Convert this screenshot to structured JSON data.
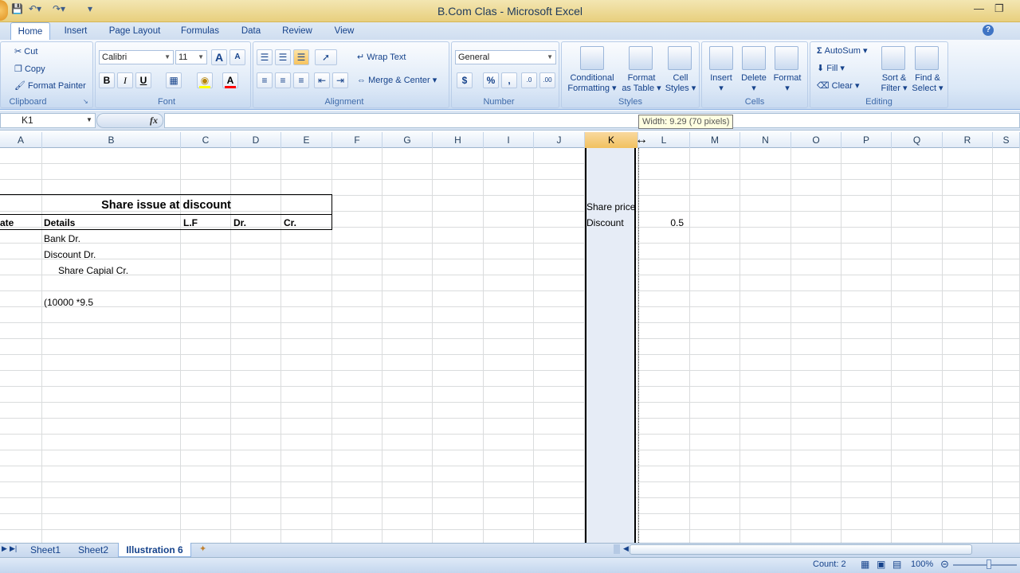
{
  "window": {
    "title": "B.Com Clas - Microsoft Excel"
  },
  "tabs": [
    "Home",
    "Insert",
    "Page Layout",
    "Formulas",
    "Data",
    "Review",
    "View"
  ],
  "clipboard": {
    "cut": "Cut",
    "copy": "Copy",
    "format_painter": "Format Painter",
    "label": "Clipboard"
  },
  "font": {
    "name": "Calibri",
    "size": "11",
    "label": "Font",
    "bold": "B",
    "italic": "I",
    "underline": "U",
    "grow": "A",
    "shrink": "A",
    "color": "A"
  },
  "alignment": {
    "wrap": "Wrap Text",
    "merge": "Merge & Center",
    "label": "Alignment"
  },
  "number": {
    "format": "General",
    "label": "Number",
    "currency": "$",
    "percent": "%",
    "comma": ","
  },
  "styles": {
    "conditional_1": "Conditional",
    "conditional_2": "Formatting",
    "format_table_1": "Format",
    "format_table_2": "as Table",
    "cell_styles_1": "Cell",
    "cell_styles_2": "Styles",
    "label": "Styles"
  },
  "cells": {
    "insert": "Insert",
    "delete": "Delete",
    "format": "Format",
    "label": "Cells"
  },
  "editing": {
    "autosum": "AutoSum",
    "fill": "Fill",
    "clear": "Clear",
    "sort_1": "Sort &",
    "sort_2": "Filter",
    "find_1": "Find &",
    "find_2": "Select",
    "label": "Editing"
  },
  "formula_bar": {
    "name_box": "K1",
    "fx": "fx",
    "tooltip": "Width: 9.29 (70 pixels)"
  },
  "columns": [
    "A",
    "B",
    "C",
    "D",
    "E",
    "F",
    "G",
    "H",
    "I",
    "J",
    "K",
    "L",
    "M",
    "N",
    "O",
    "P",
    "Q",
    "R",
    "S"
  ],
  "sheet": {
    "title": "Share issue at discount",
    "headers": {
      "date": "ate",
      "details": "Details",
      "lf": "L.F",
      "dr": "Dr.",
      "cr": "Cr."
    },
    "rows": [
      "Bank Dr.",
      "Discount Dr.",
      "Share Capial Cr.",
      "(10000 *9.5"
    ],
    "k_share": "Share price",
    "k_discount": "Discount",
    "l_discount": "0.5"
  },
  "sheet_tabs": [
    "Sheet1",
    "Sheet2",
    "Illustration 6"
  ],
  "status": {
    "count": "Count: 2",
    "zoom": "100%"
  }
}
